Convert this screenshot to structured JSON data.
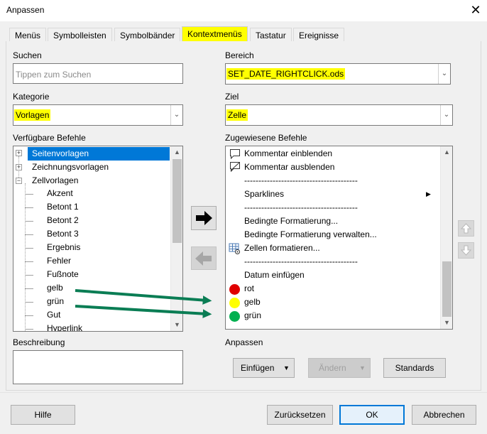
{
  "window": {
    "title": "Anpassen",
    "close_glyph": "✕"
  },
  "tabs": [
    {
      "label": "Menüs",
      "active": false
    },
    {
      "label": "Symbolleisten",
      "active": false
    },
    {
      "label": "Symbolbänder",
      "active": false
    },
    {
      "label": "Kontextmenüs",
      "active": true
    },
    {
      "label": "Tastatur",
      "active": false
    },
    {
      "label": "Ereignisse",
      "active": false
    }
  ],
  "left": {
    "search_label": "Suchen",
    "search_placeholder": "Tippen zum Suchen",
    "category_label": "Kategorie",
    "category_value": "Vorlagen",
    "available_label": "Verfügbare Befehle",
    "available_items": [
      {
        "label": "Seitenvorlagen",
        "expander": "+",
        "selected": true
      },
      {
        "label": "Zeichnungsvorlagen",
        "expander": "+",
        "selected": false
      },
      {
        "label": "Zellvorlagen",
        "expander": "−",
        "selected": false
      },
      {
        "label": "Akzent"
      },
      {
        "label": "Betont 1"
      },
      {
        "label": "Betont 2"
      },
      {
        "label": "Betont 3"
      },
      {
        "label": "Ergebnis"
      },
      {
        "label": "Fehler"
      },
      {
        "label": "Fußnote"
      },
      {
        "label": "gelb"
      },
      {
        "label": "grün"
      },
      {
        "label": "Gut"
      },
      {
        "label": "Hyperlink"
      }
    ],
    "description_label": "Beschreibung"
  },
  "right": {
    "scope_label": "Bereich",
    "scope_value": "SET_DATE_RIGHTCLICK.ods",
    "target_label": "Ziel",
    "target_value": "Zelle",
    "assigned_label": "Zugewiesene Befehle",
    "assigned_items": [
      {
        "type": "cmd",
        "label": "Kommentar einblenden",
        "icon": "comment-show-icon"
      },
      {
        "type": "cmd",
        "label": "Kommentar ausblenden",
        "icon": "comment-hide-icon"
      },
      {
        "type": "sep",
        "label": "----------------------------------------"
      },
      {
        "type": "submenu",
        "label": "Sparklines",
        "arrow": "▶"
      },
      {
        "type": "sep",
        "label": "----------------------------------------"
      },
      {
        "type": "cmd",
        "label": "Bedingte Formatierung..."
      },
      {
        "type": "cmd",
        "label": "Bedingte Formatierung verwalten..."
      },
      {
        "type": "cmd",
        "label": "Zellen formatieren...",
        "icon": "format-cells-icon"
      },
      {
        "type": "sep",
        "label": "----------------------------------------"
      },
      {
        "type": "cmd",
        "label": "Datum einfügen"
      },
      {
        "type": "color",
        "label": "rot",
        "color": "#e00000"
      },
      {
        "type": "color",
        "label": "gelb",
        "color": "#ffff00"
      },
      {
        "type": "color",
        "label": "grün",
        "color": "#00b050"
      }
    ],
    "customize_label": "Anpassen",
    "insert_label": "Einfügen",
    "modify_label": "Ändern",
    "defaults_label": "Standards"
  },
  "footer": {
    "help_label": "Hilfe",
    "reset_label": "Zurücksetzen",
    "ok_label": "OK",
    "cancel_label": "Abbrechen"
  },
  "colors": {
    "highlight": "#ffff00",
    "selection": "#0078d7",
    "annotation_arrow": "#0a7d54"
  }
}
